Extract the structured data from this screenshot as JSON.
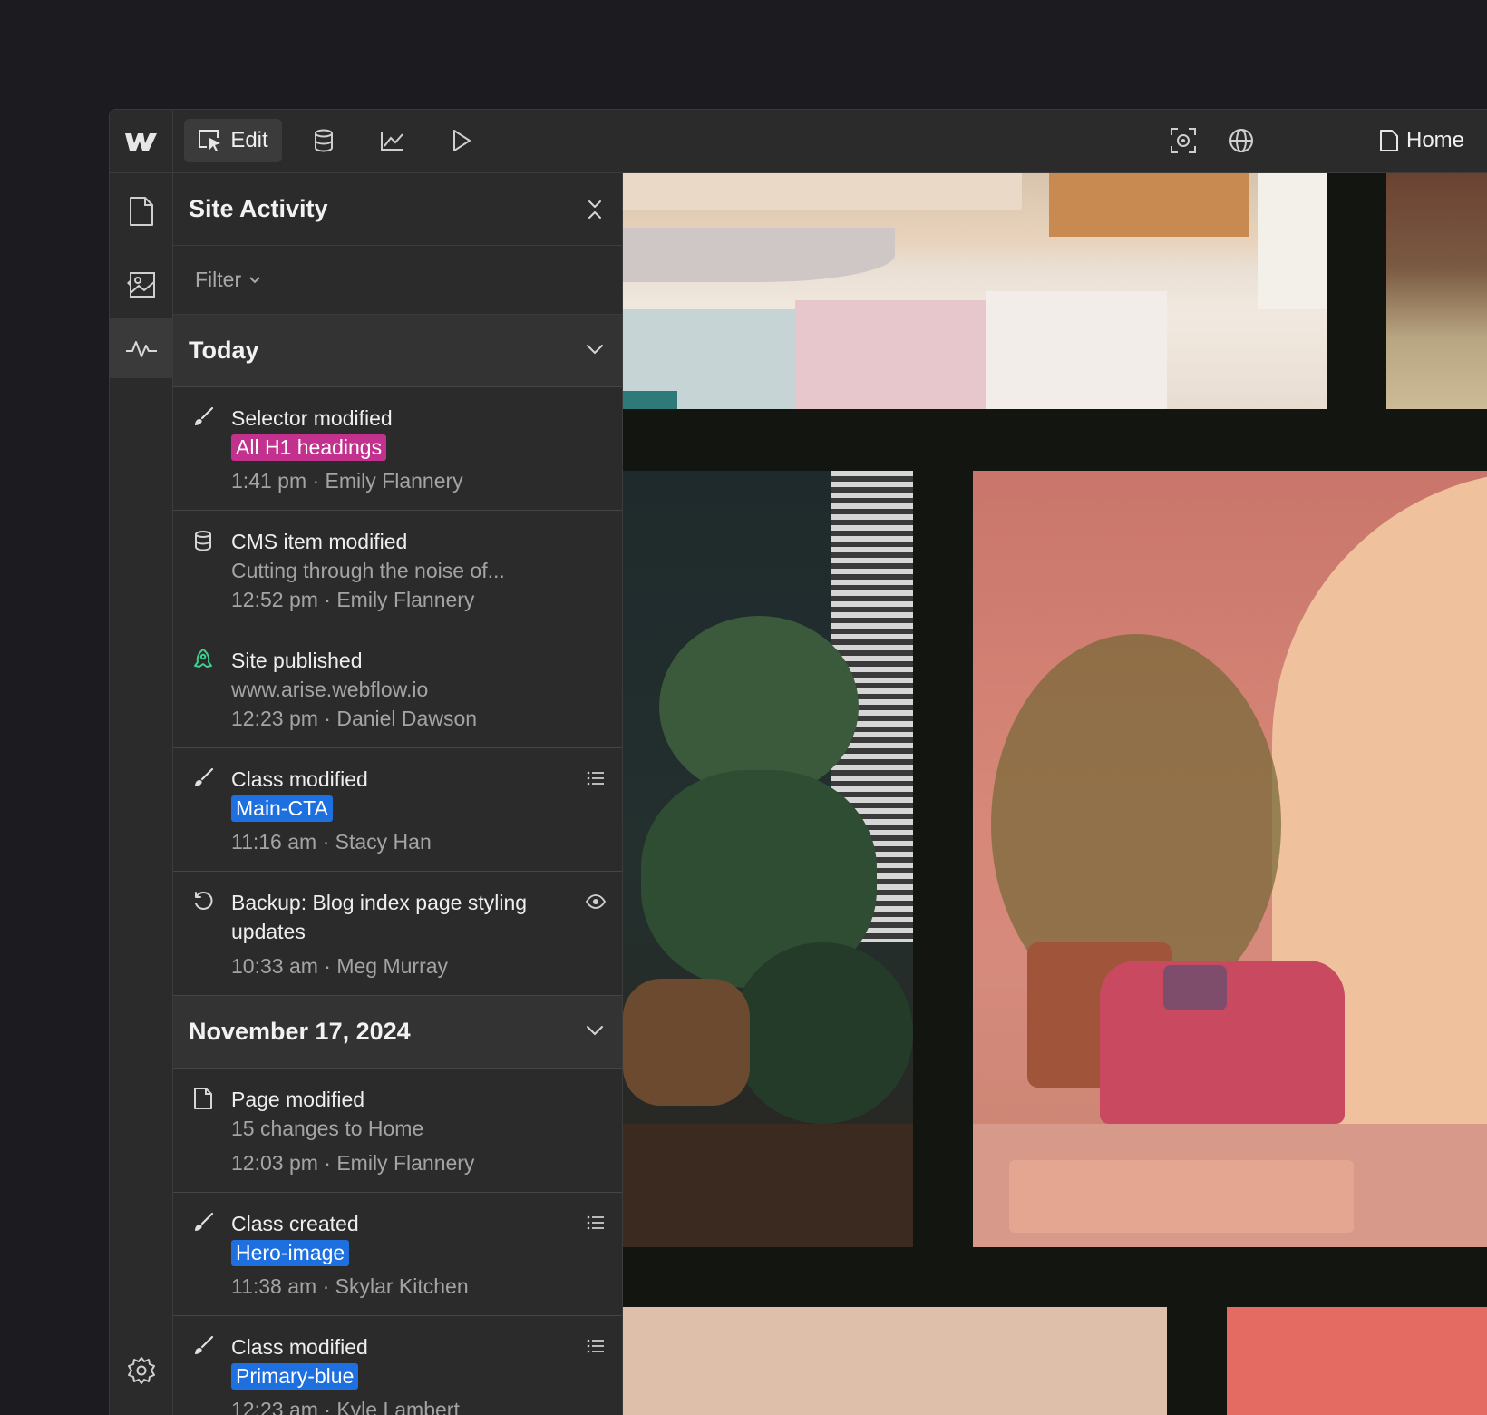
{
  "topbar": {
    "edit_label": "Edit",
    "page_label": "Home"
  },
  "panel": {
    "title": "Site Activity",
    "filter_label": "Filter"
  },
  "groups": [
    {
      "title": "Today",
      "items": [
        {
          "icon": "brush-icon",
          "title": "Selector modified",
          "tag": "All H1 headings",
          "tag_color": "#c2318d",
          "meta": "1:41 pm · Emily Flannery"
        },
        {
          "icon": "database-icon",
          "title": "CMS item modified",
          "sub": "Cutting through the noise of...",
          "meta": "12:52 pm · Emily Flannery"
        },
        {
          "icon": "rocket-icon",
          "title": "Site published",
          "sub": "www.arise.webflow.io",
          "meta": "12:23 pm · Daniel Dawson"
        },
        {
          "icon": "brush-icon",
          "title": "Class modified",
          "tag": "Main-CTA",
          "tag_color": "#1e6fe0",
          "meta": "11:16 am · Stacy Han",
          "action": "list-icon"
        },
        {
          "icon": "restore-icon",
          "title": "Backup: Blog index page styling updates",
          "meta": "10:33 am · Meg Murray",
          "action": "eye-icon"
        }
      ]
    },
    {
      "title": "November 17, 2024",
      "items": [
        {
          "icon": "page-icon",
          "title": "Page modified",
          "sub": "15 changes to Home",
          "meta": "12:03 pm · Emily Flannery"
        },
        {
          "icon": "brush-icon",
          "title": "Class created",
          "tag": "Hero-image",
          "tag_color": "#1e6fe0",
          "meta": "11:38 am · Skylar Kitchen",
          "action": "list-icon"
        },
        {
          "icon": "brush-icon",
          "title": "Class modified",
          "tag": "Primary-blue",
          "tag_color": "#1e6fe0",
          "meta": "12:23 am · Kyle Lambert",
          "action": "list-icon"
        }
      ]
    }
  ],
  "colors": {
    "accent_pink": "#c2318d",
    "accent_blue": "#1e6fe0",
    "published_green": "#3fcf8e"
  }
}
